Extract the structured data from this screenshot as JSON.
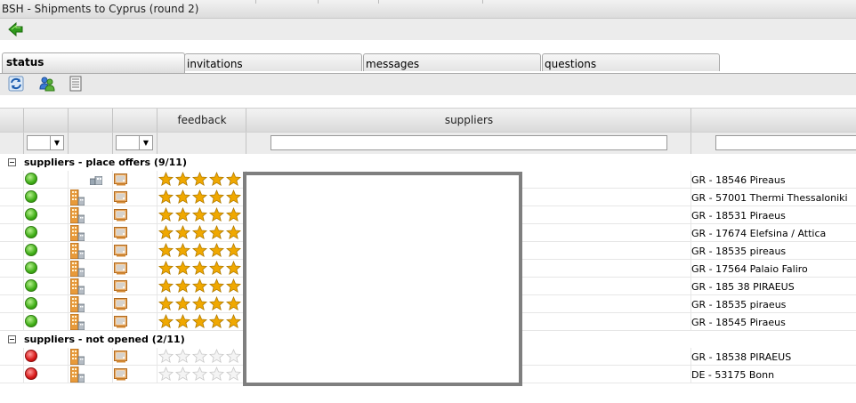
{
  "window": {
    "title": "BSH - Shipments to Cyprus (round 2)"
  },
  "toolbar": {
    "back_icon": "back-arrow-icon"
  },
  "tabs": [
    {
      "label": "status",
      "active": true
    },
    {
      "label": "invitations",
      "active": false
    },
    {
      "label": "messages",
      "active": false
    },
    {
      "label": "questions",
      "active": false
    }
  ],
  "tab_toolbar": {
    "icons": [
      "refresh-icon",
      "users-icon",
      "document-list-icon"
    ]
  },
  "grid": {
    "headers": {
      "feedback": "feedback",
      "suppliers": "suppliers"
    },
    "filters": {
      "combo1_value": "",
      "combo2_value": "",
      "suppliers_value": "",
      "last_value": ""
    },
    "groups": [
      {
        "label": "suppliers - place offers (9/11)",
        "rows": [
          {
            "status": "green",
            "building": "small",
            "rating": 5,
            "location": "GR - 18546 Pireaus"
          },
          {
            "status": "green",
            "building": "large",
            "rating": 5,
            "location": "GR - 57001 Thermi Thessaloniki"
          },
          {
            "status": "green",
            "building": "large",
            "rating": 5,
            "location": "GR - 18531 Piraeus"
          },
          {
            "status": "green",
            "building": "large",
            "rating": 5,
            "location": "GR - 17674 Elefsina / Attica"
          },
          {
            "status": "green",
            "building": "large",
            "rating": 5,
            "location": "GR - 18535 pireaus"
          },
          {
            "status": "green",
            "building": "large",
            "rating": 5,
            "location": "GR - 17564 Palaio Faliro"
          },
          {
            "status": "green",
            "building": "large",
            "rating": 5,
            "location": "GR - 185 38 PIRAEUS"
          },
          {
            "status": "green",
            "building": "large",
            "rating": 5,
            "location": "GR - 18535 piraeus"
          },
          {
            "status": "green",
            "building": "large",
            "rating": 5,
            "location": "GR - 18545 Piraeus"
          }
        ]
      },
      {
        "label": "suppliers - not opened (2/11)",
        "rows": [
          {
            "status": "red",
            "building": "large",
            "rating": 0,
            "location": "GR - 18538 PIRAEUS"
          },
          {
            "status": "red",
            "building": "large",
            "rating": 0,
            "location": "DE - 53175 Bonn"
          }
        ]
      }
    ]
  },
  "colors": {
    "status_green": "#3fae16",
    "status_red": "#d81818",
    "star_gold": "#f0a800"
  }
}
